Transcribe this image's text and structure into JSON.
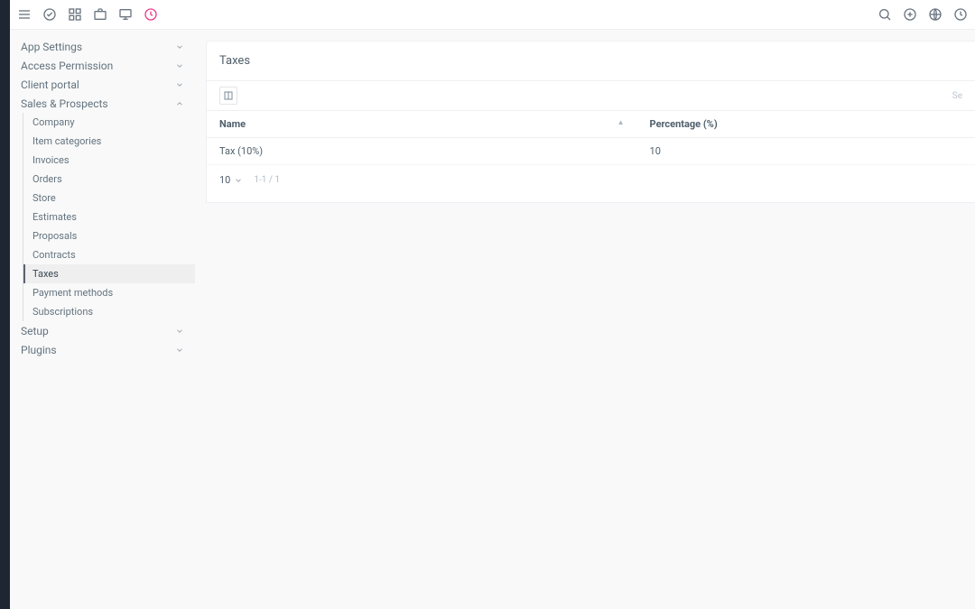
{
  "topbar": {
    "search_hint": "Se"
  },
  "sidebar": {
    "groups": [
      {
        "label": "App Settings",
        "expanded": false
      },
      {
        "label": "Access Permission",
        "expanded": false
      },
      {
        "label": "Client portal",
        "expanded": false
      },
      {
        "label": "Sales & Prospects",
        "expanded": true,
        "items": [
          {
            "label": "Company"
          },
          {
            "label": "Item categories"
          },
          {
            "label": "Invoices"
          },
          {
            "label": "Orders"
          },
          {
            "label": "Store"
          },
          {
            "label": "Estimates"
          },
          {
            "label": "Proposals"
          },
          {
            "label": "Contracts"
          },
          {
            "label": "Taxes",
            "active": true
          },
          {
            "label": "Payment methods"
          },
          {
            "label": "Subscriptions"
          }
        ]
      },
      {
        "label": "Setup",
        "expanded": false
      },
      {
        "label": "Plugins",
        "expanded": false
      }
    ]
  },
  "page": {
    "title": "Taxes",
    "columns": {
      "name": "Name",
      "percentage": "Percentage (%)"
    },
    "rows": [
      {
        "name": "Tax (10%)",
        "percentage": "10"
      }
    ],
    "page_size": "10",
    "page_info": "1-1 / 1"
  }
}
